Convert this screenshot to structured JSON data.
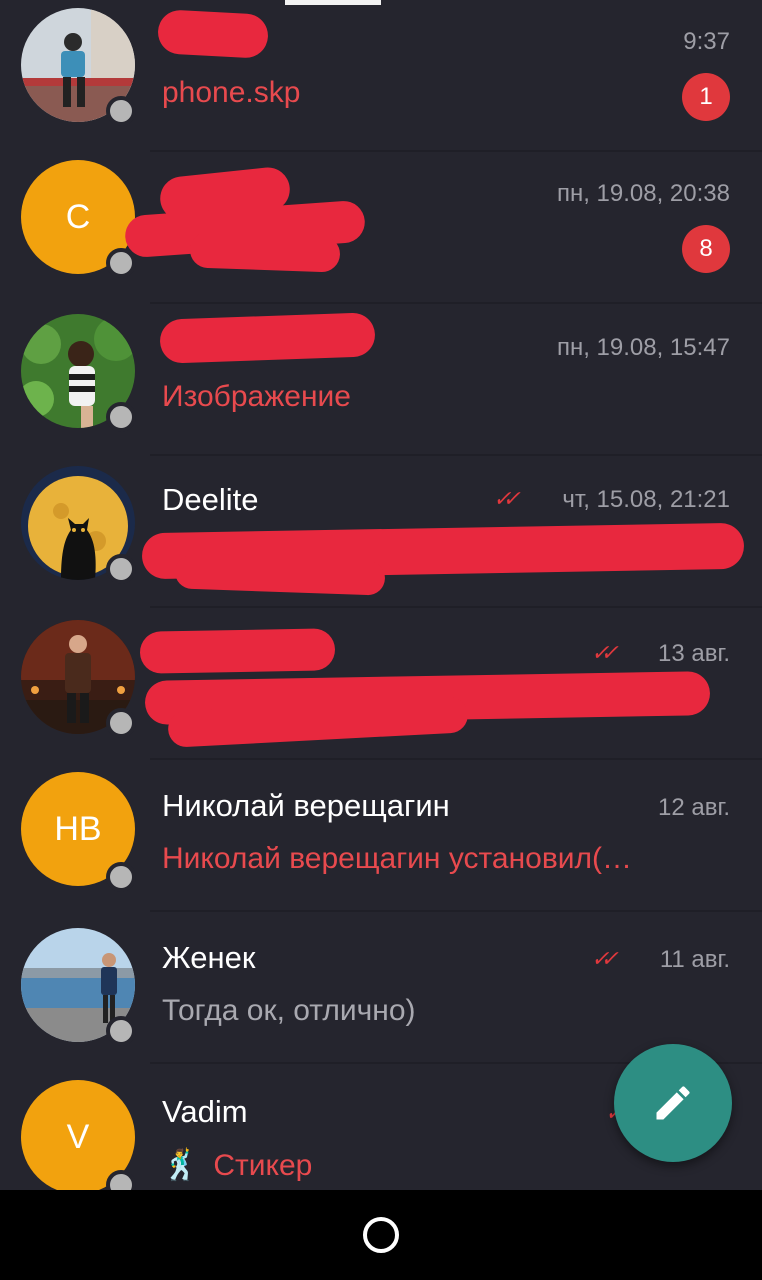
{
  "chats": [
    {
      "name": "",
      "time": "9:37",
      "message": "phone.skp",
      "message_style": "red",
      "badge": "1",
      "avatar_letters": "",
      "avatar_kind": "photo-person-bench",
      "read": false
    },
    {
      "name": "",
      "time": "пн, 19.08, 20:38",
      "message": "",
      "message_style": "gray",
      "badge": "8",
      "avatar_letters": "С",
      "avatar_kind": "letter",
      "read": false
    },
    {
      "name": "",
      "time": "пн, 19.08, 15:47",
      "message": "Изображение",
      "message_style": "red",
      "badge": "",
      "avatar_letters": "",
      "avatar_kind": "photo-woman-plants",
      "read": false
    },
    {
      "name": "Deelite",
      "time": "чт, 15.08, 21:21",
      "message": "",
      "message_style": "gray",
      "badge": "",
      "avatar_letters": "",
      "avatar_kind": "photo-cat-moon",
      "read": true
    },
    {
      "name": "",
      "time": "13 авг.",
      "message": "",
      "message_style": "gray",
      "badge": "",
      "avatar_letters": "",
      "avatar_kind": "photo-man-stage",
      "read": true
    },
    {
      "name": "Николай верещагин",
      "time": "12 авг.",
      "message": "Николай верещагин установил(…",
      "message_style": "red",
      "badge": "",
      "avatar_letters": "НВ",
      "avatar_kind": "letter",
      "read": false
    },
    {
      "name": "Женек",
      "time": "11 авг.",
      "message": "Тогда ок, отлично)",
      "message_style": "gray",
      "badge": "",
      "avatar_letters": "",
      "avatar_kind": "photo-man-sea",
      "read": true
    },
    {
      "name": "Vadim",
      "time": "",
      "message": "Стикер",
      "message_style": "red",
      "badge": "",
      "avatar_letters": "V",
      "avatar_kind": "letter",
      "read": true
    }
  ],
  "sticker_emoji": "🕺",
  "fab": {
    "icon": "pencil-icon"
  },
  "navbar": {
    "icon": "home-circle-icon"
  },
  "colors": {
    "background": "#25252e",
    "accent_red": "#e0383d",
    "avatar_orange": "#f2a20e",
    "fab_teal": "#2d8e83",
    "status_gray": "#b6b6b6"
  }
}
